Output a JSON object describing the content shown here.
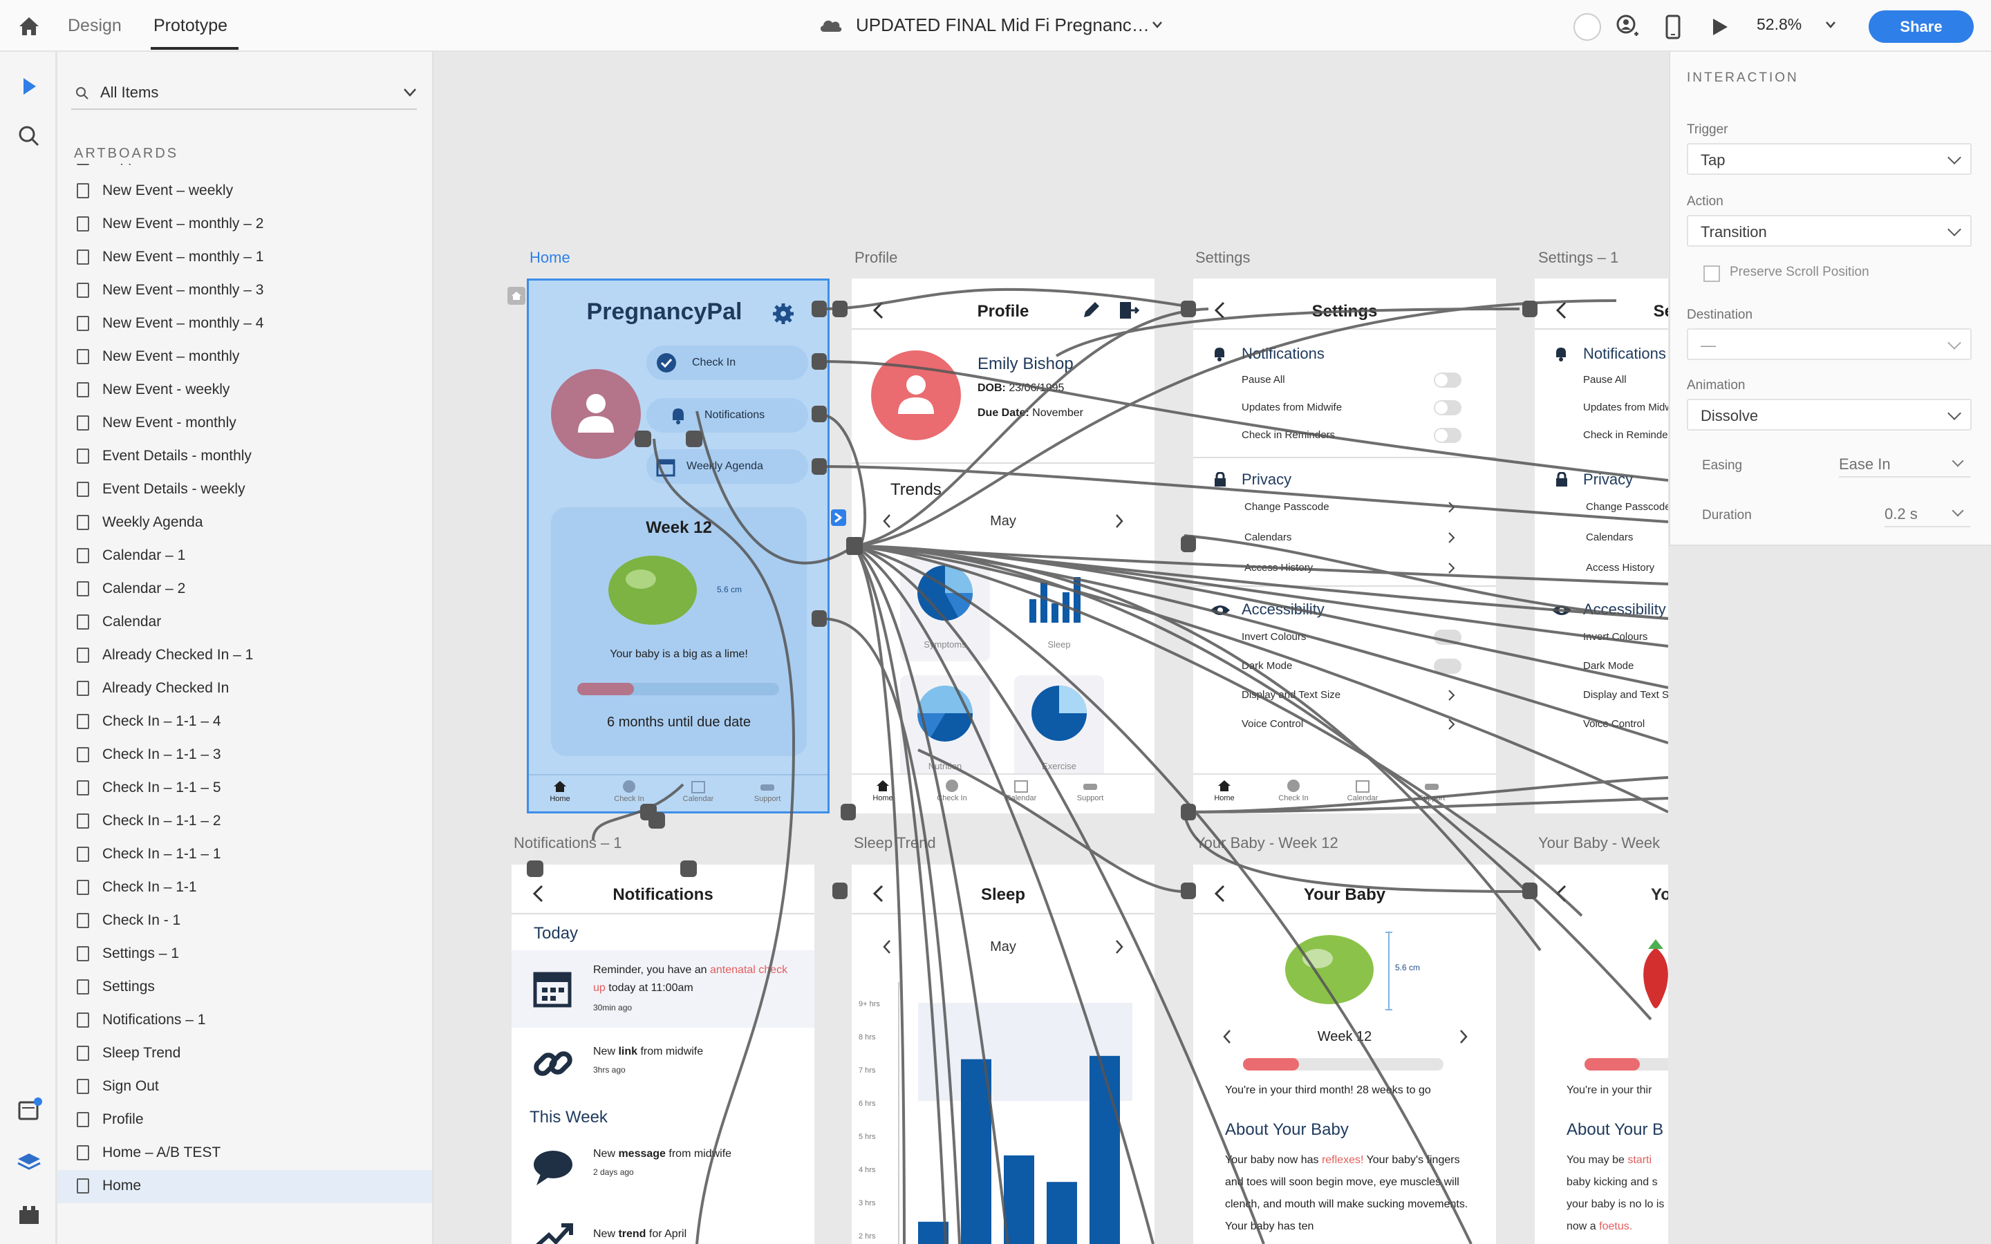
{
  "topbar": {
    "tabs": [
      "Design",
      "Prototype"
    ],
    "active_tab": "Prototype",
    "document_title": "UPDATED FINAL Mid Fi Pregnanc…",
    "zoom": "52.8%",
    "share_label": "Share"
  },
  "layers": {
    "search_label": "All Items",
    "section_title": "ARTBOARDS",
    "items": [
      "Support",
      "New Event –  weekly",
      "New Event – monthly – 2",
      "New Event – monthly – 1",
      "New Event – monthly – 3",
      "New Event – monthly – 4",
      "New Event – monthly",
      "New Event - weekly",
      "New Event - monthly",
      "Event Details - monthly",
      "Event Details - weekly",
      "Weekly Agenda",
      "Calendar – 1",
      "Calendar – 2",
      "Calendar",
      "Already Checked In – 1",
      "Already Checked In",
      "Check In – 1-1 – 4",
      "Check In – 1-1 – 3",
      "Check In – 1-1 – 5",
      "Check In – 1-1 – 2",
      "Check In – 1-1 – 1",
      "Check In – 1-1",
      "Check In - 1",
      "Settings – 1",
      "Settings",
      "Notifications – 1",
      "Sleep Trend",
      "Sign Out",
      "Profile",
      "Home – A/B TEST",
      "Home"
    ],
    "selected": "Home"
  },
  "canvas": {
    "artboard_labels": {
      "home": "Home",
      "profile": "Profile",
      "settings": "Settings",
      "settings1": "Settings – 1",
      "notifications1": "Notifications – 1",
      "sleep_trend": "Sleep Trend",
      "baby_week12": "Your Baby - Week 12",
      "baby_week": "Your Baby - Week"
    },
    "home": {
      "title": "PregnancyPal",
      "check_in": "Check In",
      "notifications": "Notifications",
      "weekly_agenda": "Weekly Agenda",
      "week": "Week 12",
      "size": "5.6 cm",
      "baby_text": "Your baby is a big as a lime!",
      "due_text": "6 months until due date",
      "progress": 0.28,
      "tabs": [
        "Home",
        "Check In",
        "Calendar",
        "Support"
      ]
    },
    "profile": {
      "title": "Profile",
      "name": "Emily Bishop",
      "dob_label": "DOB:",
      "dob": "23/06/1995",
      "due_label": "Due Date:",
      "due": "November",
      "trends": "Trends",
      "month": "May",
      "tiles": [
        "Symptoms",
        "Sleep",
        "Nutrition",
        "Exercise"
      ],
      "tabs": [
        "Home",
        "Check In",
        "Calendar",
        "Support"
      ]
    },
    "settings": {
      "title": "Settings",
      "notifications": "Notifications",
      "pause_all": "Pause All",
      "updates": "Updates from Midwife",
      "checkin_rem": "Check in Reminders",
      "privacy": "Privacy",
      "change_passcode": "Change Passcode",
      "calendars": "Calendars",
      "access_history": "Access History",
      "accessibility": "Accessibility",
      "invert": "Invert Colours",
      "dark": "Dark Mode",
      "display": "Display and Text Size",
      "voice": "Voice Control",
      "tabs": [
        "Home",
        "Check In",
        "Calendar",
        "Support"
      ]
    },
    "settings1": {
      "title": "Settings",
      "notifications": "Notifications",
      "pause_all": "Pause All",
      "updates": "Updates from Midwife",
      "checkin_rem": "Check in Reminders",
      "privacy": "Privacy",
      "change_passcode": "Change Passcode",
      "calendars": "Calendars",
      "access_history": "Access History",
      "accessibility": "Accessibility",
      "invert": "Invert Colours",
      "dark": "Dark Mode",
      "display": "Display and Text Size",
      "voice": "Voice Control"
    },
    "notifications": {
      "title": "Notifications",
      "today": "Today",
      "n1_a": "Reminder, you have an ",
      "n1_b": "antenatal check up",
      "n1_c": " today at 11:00am",
      "n1_time": "30min ago",
      "n2_a": "New ",
      "n2_b": "link",
      "n2_c": " from midwife",
      "n2_time": "3hrs ago",
      "this_week": "This Week",
      "n3_a": "New ",
      "n3_b": "message",
      "n3_c": " from midwife",
      "n3_time": "2 days ago",
      "n4_a": "New ",
      "n4_b": "trend",
      "n4_c": " for April"
    },
    "sleep": {
      "title": "Sleep",
      "month": "May",
      "y_ticks": [
        "9+ hrs",
        "8 hrs",
        "7 hrs",
        "6 hrs",
        "5 hrs",
        "4 hrs",
        "3 hrs",
        "2 hrs"
      ],
      "bars": [
        2.4,
        7.3,
        4.4,
        3.6,
        7.4
      ]
    },
    "baby": {
      "title": "Your Baby",
      "size": "5.6 cm",
      "week": "Week 12",
      "progress": 0.28,
      "third_month": "You're in your third month! 28 weeks to go",
      "about": "About Your Baby",
      "p1": "Your baby now has ",
      "p1_red": "reflexes!",
      "p1_rest": " Your baby's fingers and toes will soon begin move, eye muscles will clench, and mouth will make sucking movements. Your baby has ten"
    },
    "baby2": {
      "title": "Yo",
      "third_month": "You're in your thir",
      "about": "About Your B",
      "p1": "You may be ",
      "p1_red": "starti",
      "p1_rest": " baby kicking and s your baby is no lo",
      "p2": "is now a ",
      "p2_red": "foetus."
    }
  },
  "inspector": {
    "header": "INTERACTION",
    "trigger_label": "Trigger",
    "trigger": "Tap",
    "action_label": "Action",
    "action": "Transition",
    "preserve": "Preserve Scroll Position",
    "destination_label": "Destination",
    "destination": "—",
    "animation_label": "Animation",
    "animation": "Dissolve",
    "easing_label": "Easing",
    "easing": "Ease In",
    "duration_label": "Duration",
    "duration": "0.2 s"
  }
}
